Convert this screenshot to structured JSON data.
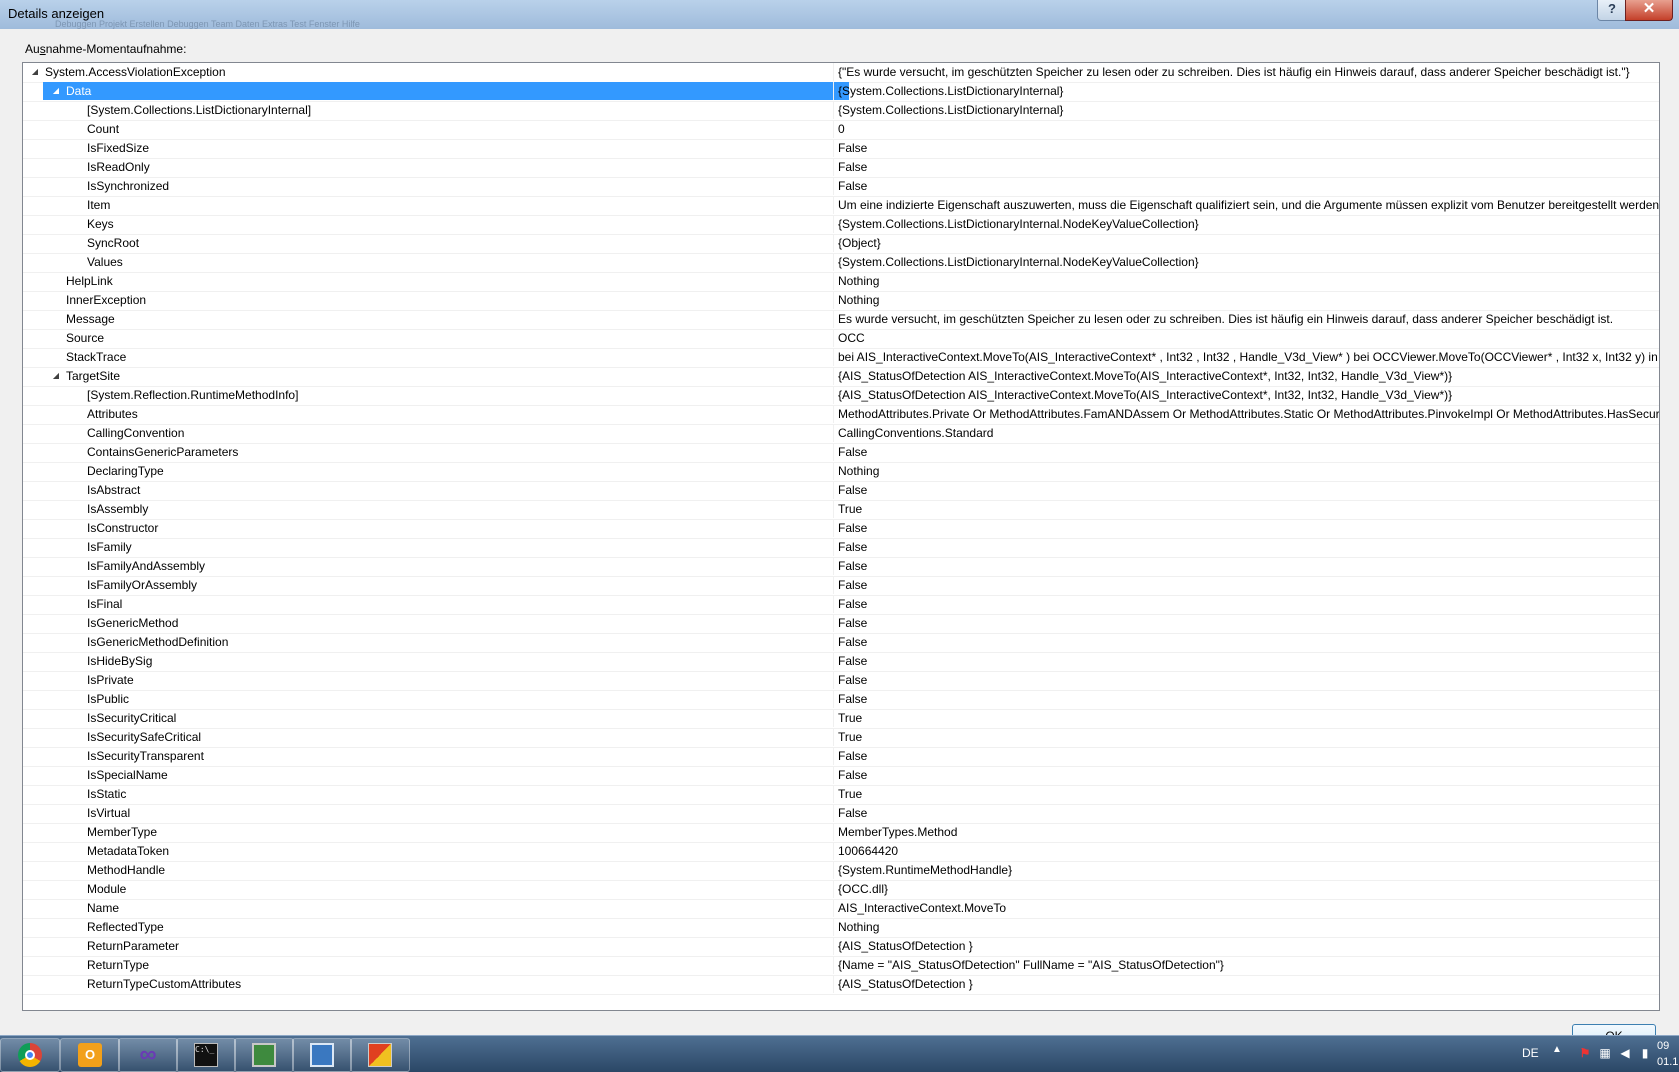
{
  "window": {
    "title": "Details anzeigen",
    "ghost_title": "Debuggen    Projekt    Erstellen    Debuggen    Team    Daten    Extras    Test    Fenster    Hilfe",
    "help_label": "?",
    "close_label": "✕"
  },
  "dialog": {
    "caption_prefix": "Au",
    "caption_access": "s",
    "caption_rest": "nahme-Momentaufnahme:",
    "ok_label": "OK"
  },
  "tree": {
    "rows": [
      {
        "level": 0,
        "expander": "◢",
        "name": "System.AccessViolationException",
        "value": "{\"Es wurde versucht, im geschützten Speicher zu lesen oder zu schreiben. Dies ist häufig ein Hinweis darauf, dass anderer Speicher beschädigt ist.\"}"
      },
      {
        "level": 1,
        "expander": "◢",
        "name": "Data",
        "value": "{System.Collections.ListDictionaryInternal}",
        "selected": true
      },
      {
        "level": 2,
        "expander": "",
        "name": "[System.Collections.ListDictionaryInternal]",
        "value": "{System.Collections.ListDictionaryInternal}"
      },
      {
        "level": 2,
        "expander": "",
        "name": "Count",
        "value": "0"
      },
      {
        "level": 2,
        "expander": "",
        "name": "IsFixedSize",
        "value": "False"
      },
      {
        "level": 2,
        "expander": "",
        "name": "IsReadOnly",
        "value": "False"
      },
      {
        "level": 2,
        "expander": "",
        "name": "IsSynchronized",
        "value": "False"
      },
      {
        "level": 2,
        "expander": "",
        "name": "Item",
        "value": "Um eine indizierte Eigenschaft auszuwerten, muss die Eigenschaft qualifiziert sein, und die Argumente müssen explizit vom Benutzer bereitgestellt werden."
      },
      {
        "level": 2,
        "expander": "",
        "name": "Keys",
        "value": "{System.Collections.ListDictionaryInternal.NodeKeyValueCollection}"
      },
      {
        "level": 2,
        "expander": "",
        "name": "SyncRoot",
        "value": "{Object}"
      },
      {
        "level": 2,
        "expander": "",
        "name": "Values",
        "value": "{System.Collections.ListDictionaryInternal.NodeKeyValueCollection}"
      },
      {
        "level": 1,
        "expander": "",
        "name": "HelpLink",
        "value": "Nothing"
      },
      {
        "level": 1,
        "expander": "",
        "name": "InnerException",
        "value": "Nothing"
      },
      {
        "level": 1,
        "expander": "",
        "name": "Message",
        "value": "Es wurde versucht, im geschützten Speicher zu lesen oder zu schreiben. Dies ist häufig ein Hinweis darauf, dass anderer Speicher beschädigt ist."
      },
      {
        "level": 1,
        "expander": "",
        "name": "Source",
        "value": "OCC"
      },
      {
        "level": 1,
        "expander": "",
        "name": "StackTrace",
        "value": "   bei AIS_InteractiveContext.MoveTo(AIS_InteractiveContext* , Int32 , Int32 , Handle_V3d_View* )    bei OCCViewer.MoveTo(OCCViewer* , Int32 x, Int32 y) in c:\\"
      },
      {
        "level": 1,
        "expander": "◢",
        "name": "TargetSite",
        "value": "{AIS_StatusOfDetection AIS_InteractiveContext.MoveTo(AIS_InteractiveContext*, Int32, Int32, Handle_V3d_View*)}"
      },
      {
        "level": 2,
        "expander": "",
        "name": "[System.Reflection.RuntimeMethodInfo]",
        "value": "{AIS_StatusOfDetection AIS_InteractiveContext.MoveTo(AIS_InteractiveContext*, Int32, Int32, Handle_V3d_View*)}"
      },
      {
        "level": 2,
        "expander": "",
        "name": "Attributes",
        "value": "MethodAttributes.Private Or MethodAttributes.FamANDAssem Or MethodAttributes.Static Or MethodAttributes.PinvokeImpl Or MethodAttributes.HasSecur"
      },
      {
        "level": 2,
        "expander": "",
        "name": "CallingConvention",
        "value": "CallingConventions.Standard"
      },
      {
        "level": 2,
        "expander": "",
        "name": "ContainsGenericParameters",
        "value": "False"
      },
      {
        "level": 2,
        "expander": "",
        "name": "DeclaringType",
        "value": "Nothing"
      },
      {
        "level": 2,
        "expander": "",
        "name": "IsAbstract",
        "value": "False"
      },
      {
        "level": 2,
        "expander": "",
        "name": "IsAssembly",
        "value": "True"
      },
      {
        "level": 2,
        "expander": "",
        "name": "IsConstructor",
        "value": "False"
      },
      {
        "level": 2,
        "expander": "",
        "name": "IsFamily",
        "value": "False"
      },
      {
        "level": 2,
        "expander": "",
        "name": "IsFamilyAndAssembly",
        "value": "False"
      },
      {
        "level": 2,
        "expander": "",
        "name": "IsFamilyOrAssembly",
        "value": "False"
      },
      {
        "level": 2,
        "expander": "",
        "name": "IsFinal",
        "value": "False"
      },
      {
        "level": 2,
        "expander": "",
        "name": "IsGenericMethod",
        "value": "False"
      },
      {
        "level": 2,
        "expander": "",
        "name": "IsGenericMethodDefinition",
        "value": "False"
      },
      {
        "level": 2,
        "expander": "",
        "name": "IsHideBySig",
        "value": "False"
      },
      {
        "level": 2,
        "expander": "",
        "name": "IsPrivate",
        "value": "False"
      },
      {
        "level": 2,
        "expander": "",
        "name": "IsPublic",
        "value": "False"
      },
      {
        "level": 2,
        "expander": "",
        "name": "IsSecurityCritical",
        "value": "True"
      },
      {
        "level": 2,
        "expander": "",
        "name": "IsSecuritySafeCritical",
        "value": "True"
      },
      {
        "level": 2,
        "expander": "",
        "name": "IsSecurityTransparent",
        "value": "False"
      },
      {
        "level": 2,
        "expander": "",
        "name": "IsSpecialName",
        "value": "False"
      },
      {
        "level": 2,
        "expander": "",
        "name": "IsStatic",
        "value": "True"
      },
      {
        "level": 2,
        "expander": "",
        "name": "IsVirtual",
        "value": "False"
      },
      {
        "level": 2,
        "expander": "",
        "name": "MemberType",
        "value": "MemberTypes.Method"
      },
      {
        "level": 2,
        "expander": "",
        "name": "MetadataToken",
        "value": "100664420"
      },
      {
        "level": 2,
        "expander": "",
        "name": "MethodHandle",
        "value": "{System.RuntimeMethodHandle}"
      },
      {
        "level": 2,
        "expander": "",
        "name": "Module",
        "value": "{OCC.dll}"
      },
      {
        "level": 2,
        "expander": "",
        "name": "Name",
        "value": "AIS_InteractiveContext.MoveTo"
      },
      {
        "level": 2,
        "expander": "",
        "name": "ReflectedType",
        "value": "Nothing"
      },
      {
        "level": 2,
        "expander": "",
        "name": "ReturnParameter",
        "value": "{AIS_StatusOfDetection }"
      },
      {
        "level": 2,
        "expander": "",
        "name": "ReturnType",
        "value": "{Name = \"AIS_StatusOfDetection\" FullName = \"AIS_StatusOfDetection\"}"
      },
      {
        "level": 2,
        "expander": "",
        "name": "ReturnTypeCustomAttributes",
        "value": "{AIS_StatusOfDetection }"
      }
    ]
  },
  "taskbar": {
    "buttons": [
      {
        "name": "chrome-taskbar-button",
        "icon": "chrome-icon",
        "glyph": ""
      },
      {
        "name": "outlook-taskbar-button",
        "icon": "outlook-icon",
        "glyph": "O"
      },
      {
        "name": "visual-studio-taskbar-button",
        "icon": "visual-studio-icon",
        "glyph": "∞"
      },
      {
        "name": "command-prompt-taskbar-button",
        "icon": "command-prompt-icon",
        "glyph": "C:\\_"
      },
      {
        "name": "monitor-taskbar-button",
        "icon": "monitor-icon",
        "glyph": ""
      },
      {
        "name": "network-config-taskbar-button",
        "icon": "network-config-icon",
        "glyph": ""
      },
      {
        "name": "app-taskbar-button",
        "icon": "app-icon",
        "glyph": ""
      }
    ],
    "language": "DE",
    "tray_arrow": "▲",
    "clock_line1": "09",
    "clock_line2": "01.1"
  }
}
